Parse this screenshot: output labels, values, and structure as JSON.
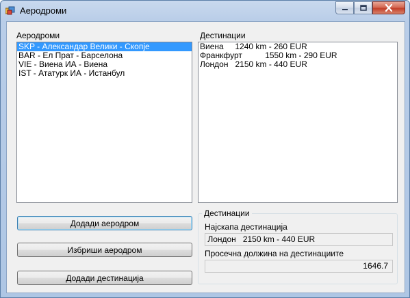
{
  "window": {
    "title": "Аеродроми",
    "icon": "app-window-icon",
    "controls": {
      "minimize_icon": "minimize-icon",
      "maximize_icon": "maximize-icon",
      "close_icon": "close-icon"
    }
  },
  "airports": {
    "label": "Аеродроми",
    "selected_index": 0,
    "items": [
      {
        "text": "SKP - Александар Велики - Скопје"
      },
      {
        "text": "BAR - Ел Прат - Барселона"
      },
      {
        "text": "VIE - Виена ИА - Виена"
      },
      {
        "text": "IST - Ататурк ИА - Истанбул"
      }
    ]
  },
  "destinations": {
    "label": "Дестинации",
    "items": [
      {
        "text": "Виена     1240 km - 260 EUR"
      },
      {
        "text": "Франкфурт          1550 km - 290 EUR"
      },
      {
        "text": "Лондон   2150 km - 440 EUR"
      }
    ]
  },
  "buttons": {
    "add_airport": "Додади аеродром",
    "delete_airport": "Избриши аеродром",
    "add_destination": "Додади дестинација"
  },
  "stats": {
    "group_title": "Дестинации",
    "cheapest_label": "Најскапа дестинација",
    "cheapest_value": " Лондон   2150 km - 440 EUR",
    "avg_label": "Просечна должина на дестинациите",
    "avg_value": "1646.7"
  },
  "colors": {
    "selection": "#3399ff",
    "close_button": "#c2402a",
    "client_background": "#f0f0f0"
  }
}
